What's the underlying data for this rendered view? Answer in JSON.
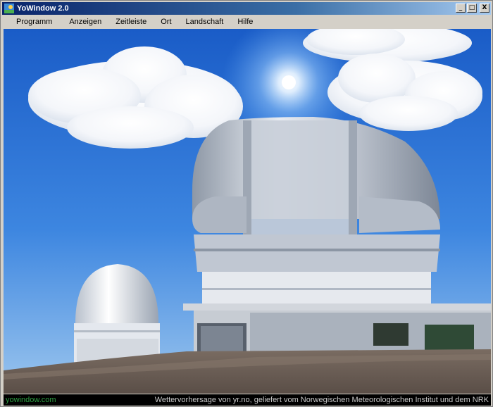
{
  "window": {
    "title": "YoWindow 2.0",
    "minimize_glyph": "_",
    "maximize_glyph": "□",
    "close_glyph": "X"
  },
  "menu": {
    "items": [
      "Programm",
      "Anzeigen",
      "Zeitleiste",
      "Ort",
      "Landschaft",
      "Hilfe"
    ]
  },
  "status": {
    "brand": "yowindow.com",
    "credit": "Wettervorhersage von yr.no, geliefert vom Norwegischen Meteorologischen Institut und dem NRK"
  },
  "colors": {
    "sky_top": "#1a5cc7",
    "sky_bottom": "#8fbde8",
    "ground": "#6b5e55",
    "brand_green": "#2ea043"
  },
  "icons": {
    "app": "yowindow-logo-icon",
    "minimize": "minimize-icon",
    "maximize": "maximize-icon",
    "close": "close-icon"
  }
}
